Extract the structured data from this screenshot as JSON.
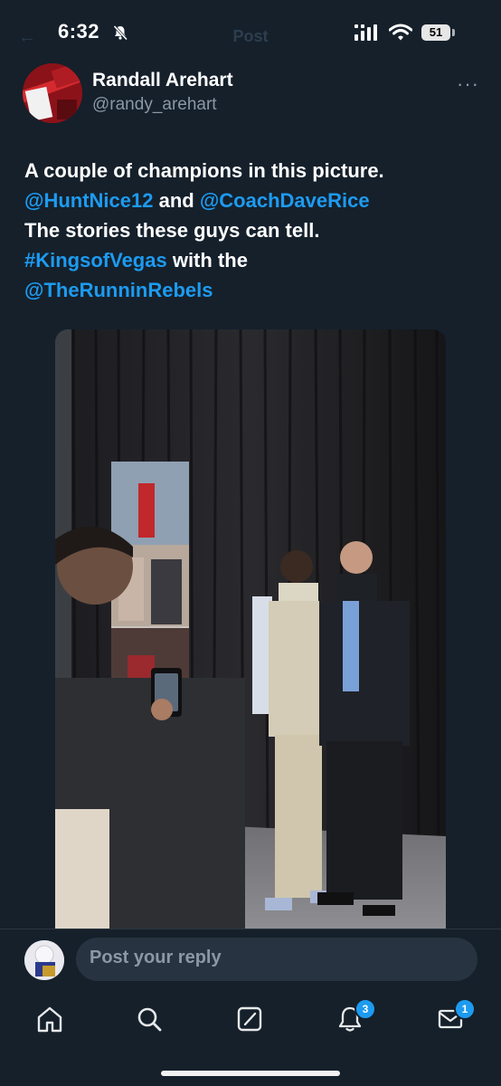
{
  "status_bar": {
    "time": "6:32",
    "battery": "51"
  },
  "header": {
    "title": "Post"
  },
  "tweet": {
    "author_name": "Randall Arehart",
    "author_handle": "@randy_arehart",
    "more_label": "···",
    "text_lines": [
      [
        {
          "t": "A couple of champions in this picture.",
          "link": false
        }
      ],
      [
        {
          "t": "@HuntNice12",
          "link": true
        },
        {
          "t": " and ",
          "link": false
        },
        {
          "t": "@CoachDaveRice",
          "link": true
        }
      ],
      [
        {
          "t": "The stories these guys can tell.",
          "link": false
        }
      ],
      [
        {
          "t": "#KingsofVegas",
          "link": true
        },
        {
          "t": " with the",
          "link": false
        }
      ],
      [
        {
          "t": "@TheRunninRebels",
          "link": true
        }
      ]
    ]
  },
  "reply": {
    "placeholder": "Post your reply"
  },
  "tabs": [
    {
      "name": "home",
      "badge": null
    },
    {
      "name": "search",
      "badge": null
    },
    {
      "name": "grok",
      "badge": null
    },
    {
      "name": "notifications",
      "badge": "3"
    },
    {
      "name": "messages",
      "badge": "1"
    }
  ],
  "colors": {
    "background": "#15202b",
    "link": "#1d9bf0",
    "muted": "#8b98a5",
    "input": "#273340"
  }
}
